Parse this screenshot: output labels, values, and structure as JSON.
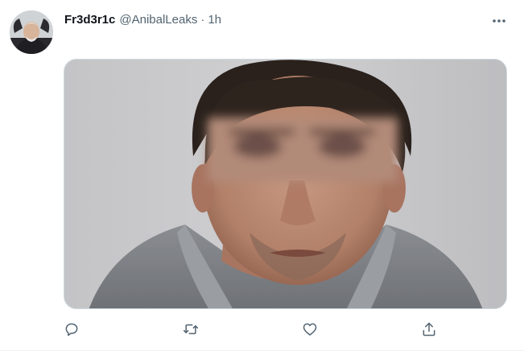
{
  "tweet": {
    "display_name": "Fr3d3r1c",
    "handle": "@AnibalLeaks",
    "separator": "·",
    "time": "1h"
  },
  "icons": {
    "more": "more-horizontal-icon",
    "reply": "reply-icon",
    "retweet": "retweet-icon",
    "like": "heart-icon",
    "share": "share-icon"
  },
  "colors": {
    "text_primary": "#0f1419",
    "text_secondary": "#536471",
    "border": "#cfd9de"
  }
}
